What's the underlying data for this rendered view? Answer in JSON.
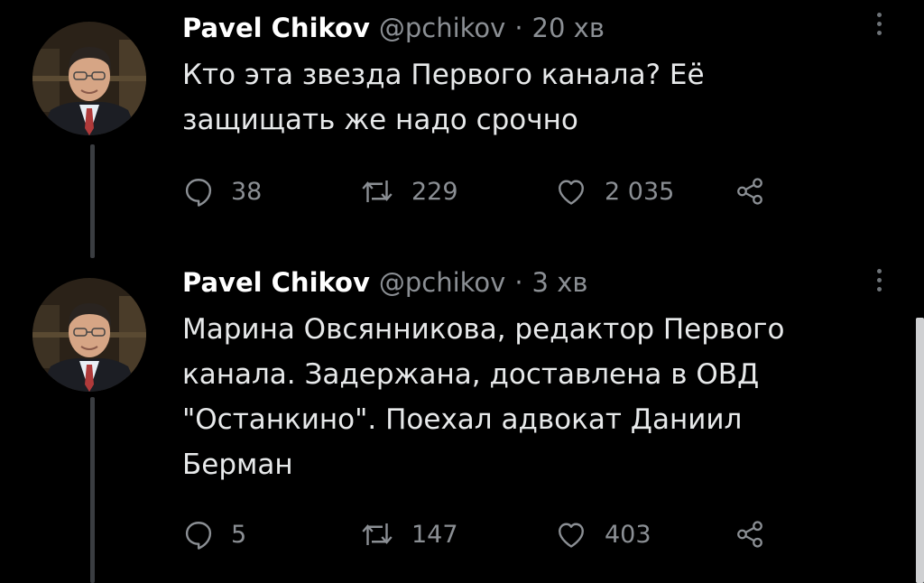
{
  "colors": {
    "background": "#000000",
    "text": "#e7e9ea",
    "muted": "#8b8f94"
  },
  "tweets": [
    {
      "name": "Pavel Chikov",
      "handle": "@pchikov",
      "separator": "·",
      "time": "20 хв",
      "lines": [
        "Кто эта звезда Первого канала? Её",
        "защищать же надо срочно"
      ],
      "replies": "38",
      "retweets": "229",
      "likes": "2 035"
    },
    {
      "name": "Pavel Chikov",
      "handle": "@pchikov",
      "separator": "·",
      "time": "3 хв",
      "lines": [
        "Марина Овсянникова, редактор Первого",
        "канала. Задержана, доставлена в ОВД",
        "\"Останкино\". Поехал адвокат Даниил",
        "Берман"
      ],
      "replies": "5",
      "retweets": "147",
      "likes": "403"
    }
  ],
  "icons": {
    "avatar": "profile-photo",
    "reply": "speech-bubble-icon",
    "retweet": "retweet-icon",
    "like": "heart-icon",
    "share": "share-icon",
    "more": "more-vertical-icon"
  }
}
